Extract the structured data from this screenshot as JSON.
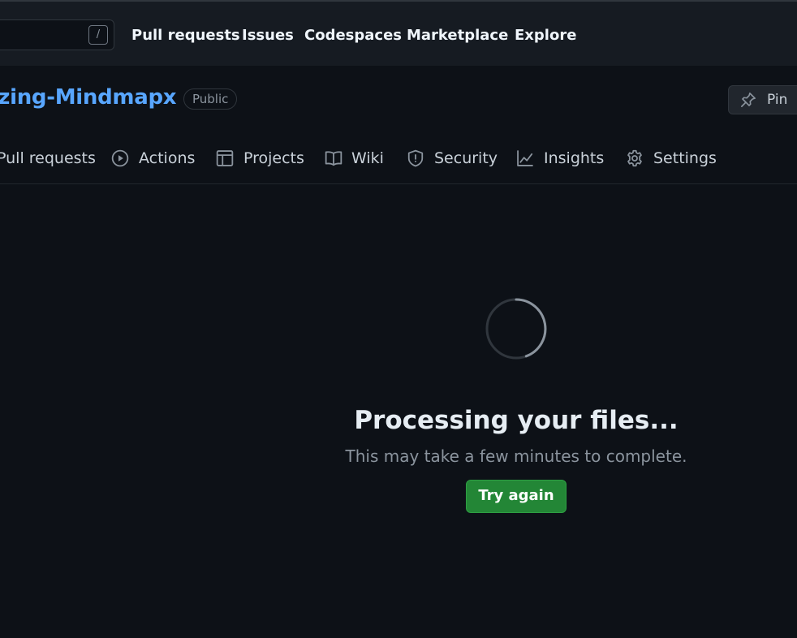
{
  "header": {
    "search_shortcut": "/",
    "nav": [
      "Pull requests",
      "Issues",
      "Codespaces",
      "Marketplace",
      "Explore"
    ]
  },
  "repo": {
    "name": "azing-Mindmapx",
    "visibility": "Public",
    "pin_label": "Pin"
  },
  "tabs": [
    {
      "label": "Pull requests",
      "icon": "pull-request-icon"
    },
    {
      "label": "Actions",
      "icon": "play-icon"
    },
    {
      "label": "Projects",
      "icon": "table-icon"
    },
    {
      "label": "Wiki",
      "icon": "book-icon"
    },
    {
      "label": "Security",
      "icon": "shield-icon"
    },
    {
      "label": "Insights",
      "icon": "graph-icon"
    },
    {
      "label": "Settings",
      "icon": "gear-icon"
    }
  ],
  "main": {
    "title": "Processing your files...",
    "subtitle": "This may take a few minutes to complete.",
    "button": "Try again"
  },
  "colors": {
    "background": "#0d1117",
    "header_bg": "#161b22",
    "link": "#58a6ff",
    "primary_button": "#238636"
  }
}
